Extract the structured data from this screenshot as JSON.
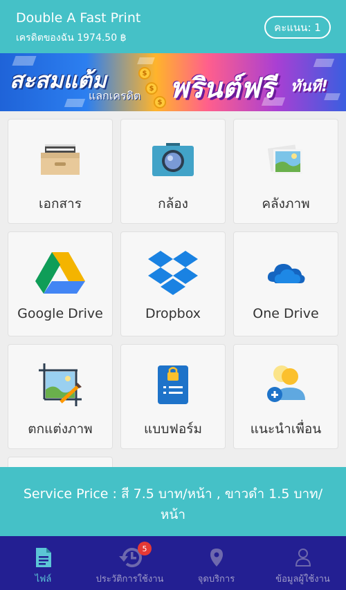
{
  "header": {
    "title": "Double A Fast Print",
    "credit": "เครดิตของฉัน 1974.50 ฿",
    "score_button": "คะแนน: 1"
  },
  "banner": {
    "main_text": "สะสมแต้ม",
    "sub_text": "แลกเครดิต",
    "free_text": "พรินต์ฟรี",
    "now_text": "ทันที!",
    "coin_symbol": "$"
  },
  "menu": [
    {
      "label": "เอกสาร",
      "icon": "document-tray-icon"
    },
    {
      "label": "กล้อง",
      "icon": "camera-icon"
    },
    {
      "label": "คลังภาพ",
      "icon": "gallery-icon"
    },
    {
      "label": "Google Drive",
      "icon": "google-drive-icon"
    },
    {
      "label": "Dropbox",
      "icon": "dropbox-icon"
    },
    {
      "label": "One Drive",
      "icon": "onedrive-icon"
    },
    {
      "label": "ตกแต่งภาพ",
      "icon": "photo-edit-icon"
    },
    {
      "label": "แบบฟอร์ม",
      "icon": "form-icon"
    },
    {
      "label": "แนะนำเพื่อน",
      "icon": "invite-friend-icon"
    }
  ],
  "service_price": "Service Price : สี 7.5 บาท/หน้า , ขาวดำ 1.5 บาท/หน้า",
  "bottom_nav": [
    {
      "label": "ไฟล์",
      "icon": "file-icon",
      "active": true
    },
    {
      "label": "ประวัติการใช้งาน",
      "icon": "history-icon",
      "badge": "5"
    },
    {
      "label": "จุดบริการ",
      "icon": "location-pin-icon"
    },
    {
      "label": "ข้อมูลผู้ใช้งาน",
      "icon": "user-icon"
    }
  ],
  "colors": {
    "header": "#45c1c7",
    "bottom_nav": "#231f92",
    "active_nav": "#5cc6d6",
    "badge": "#e53935"
  }
}
